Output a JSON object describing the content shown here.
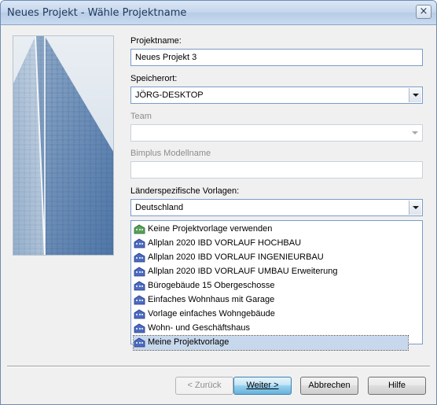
{
  "window": {
    "title": "Neues Projekt - Wähle Projektname",
    "close_glyph": "×"
  },
  "form": {
    "projektname_label": "Projektname:",
    "projektname_value": "Neues Projekt 3",
    "speicherort_label": "Speicherort:",
    "speicherort_value": "JÖRG-DESKTOP",
    "team_label": "Team",
    "team_value": "",
    "bimplus_label": "Bimplus Modellname",
    "bimplus_value": "",
    "laender_label": "Länderspezifische Vorlagen:",
    "laender_value": "Deutschland"
  },
  "templates": [
    {
      "label": "Keine Projektvorlage verwenden",
      "icon": "green-building-icon"
    },
    {
      "label": "Allplan 2020 IBD VORLAUF HOCHBAU",
      "icon": "blue-building-icon"
    },
    {
      "label": "Allplan 2020 IBD VORLAUF INGENIEURBAU",
      "icon": "blue-building-icon"
    },
    {
      "label": "Allplan 2020 IBD VORLAUF UMBAU Erweiterung",
      "icon": "blue-building-icon"
    },
    {
      "label": "Bürogebäude 15 Obergeschosse",
      "icon": "blue-building-icon"
    },
    {
      "label": "Einfaches Wohnhaus mit Garage",
      "icon": "blue-building-icon"
    },
    {
      "label": "Vorlage einfaches Wohngebäude",
      "icon": "blue-building-icon"
    },
    {
      "label": "Wohn- und Geschäftshaus",
      "icon": "blue-building-icon"
    },
    {
      "label": "Meine Projektvorlage",
      "icon": "blue-building-icon",
      "selected": true
    }
  ],
  "buttons": {
    "back": "< Zurück",
    "next": "Weiter >",
    "cancel": "Abbrechen",
    "help": "Hilfe"
  },
  "colors": {
    "accent": "#3c7fb1",
    "selection": "#c8d8ec",
    "green_icon": "#5aa05a",
    "blue_icon": "#4d6bbf"
  }
}
